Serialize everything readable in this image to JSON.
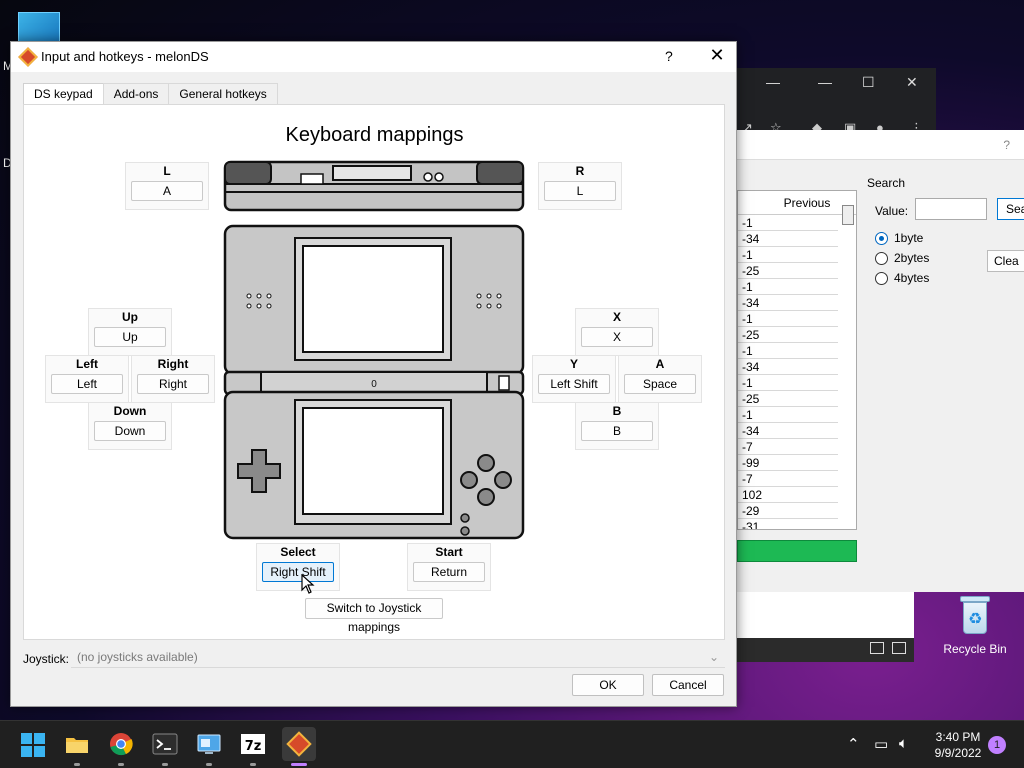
{
  "desktop": {
    "frag_m": "M",
    "frag_d": "D",
    "recycle_label": "Recycle Bin"
  },
  "memsearch": {
    "help": "?",
    "column_header": "Previous",
    "rows": [
      "-1",
      "-34",
      "-1",
      "-25",
      "-1",
      "-34",
      "-1",
      "-25",
      "-1",
      "-34",
      "-1",
      "-25",
      "-1",
      "-34",
      "-7",
      "-99",
      "-7",
      "102",
      "-29",
      "-31"
    ],
    "search_group": "Search",
    "value_label": "Value:",
    "search_btn": "Sea",
    "clear_btn": "Clea",
    "radios": [
      {
        "label": "1byte",
        "selected": true
      },
      {
        "label": "2bytes",
        "selected": false
      },
      {
        "label": "4bytes",
        "selected": false
      }
    ],
    "progress_color": "#1db954"
  },
  "dialog": {
    "title": "Input and hotkeys - melonDS",
    "help": "?",
    "close": "✕",
    "tabs": [
      "DS keypad",
      "Add-ons",
      "General hotkeys"
    ],
    "heading": "Keyboard mappings",
    "mappings": {
      "l": {
        "label": "L",
        "key": "A"
      },
      "r": {
        "label": "R",
        "key": "L"
      },
      "up": {
        "label": "Up",
        "key": "Up"
      },
      "left": {
        "label": "Left",
        "key": "Left"
      },
      "right": {
        "label": "Right",
        "key": "Right"
      },
      "down": {
        "label": "Down",
        "key": "Down"
      },
      "x": {
        "label": "X",
        "key": "X"
      },
      "y": {
        "label": "Y",
        "key": "Left Shift"
      },
      "a": {
        "label": "A",
        "key": "Space"
      },
      "b": {
        "label": "B",
        "key": "B"
      },
      "select": {
        "label": "Select",
        "key": "Right Shift"
      },
      "start": {
        "label": "Start",
        "key": "Return"
      }
    },
    "switch_btn": "Switch to Joystick mappings",
    "joystick_label": "Joystick:",
    "joystick_value": "(no joysticks available)",
    "ok": "OK",
    "cancel": "Cancel"
  },
  "taskbar": {
    "time": "3:40 PM",
    "date": "9/9/2022",
    "notifications": "1",
    "accent": "#c080ff"
  }
}
